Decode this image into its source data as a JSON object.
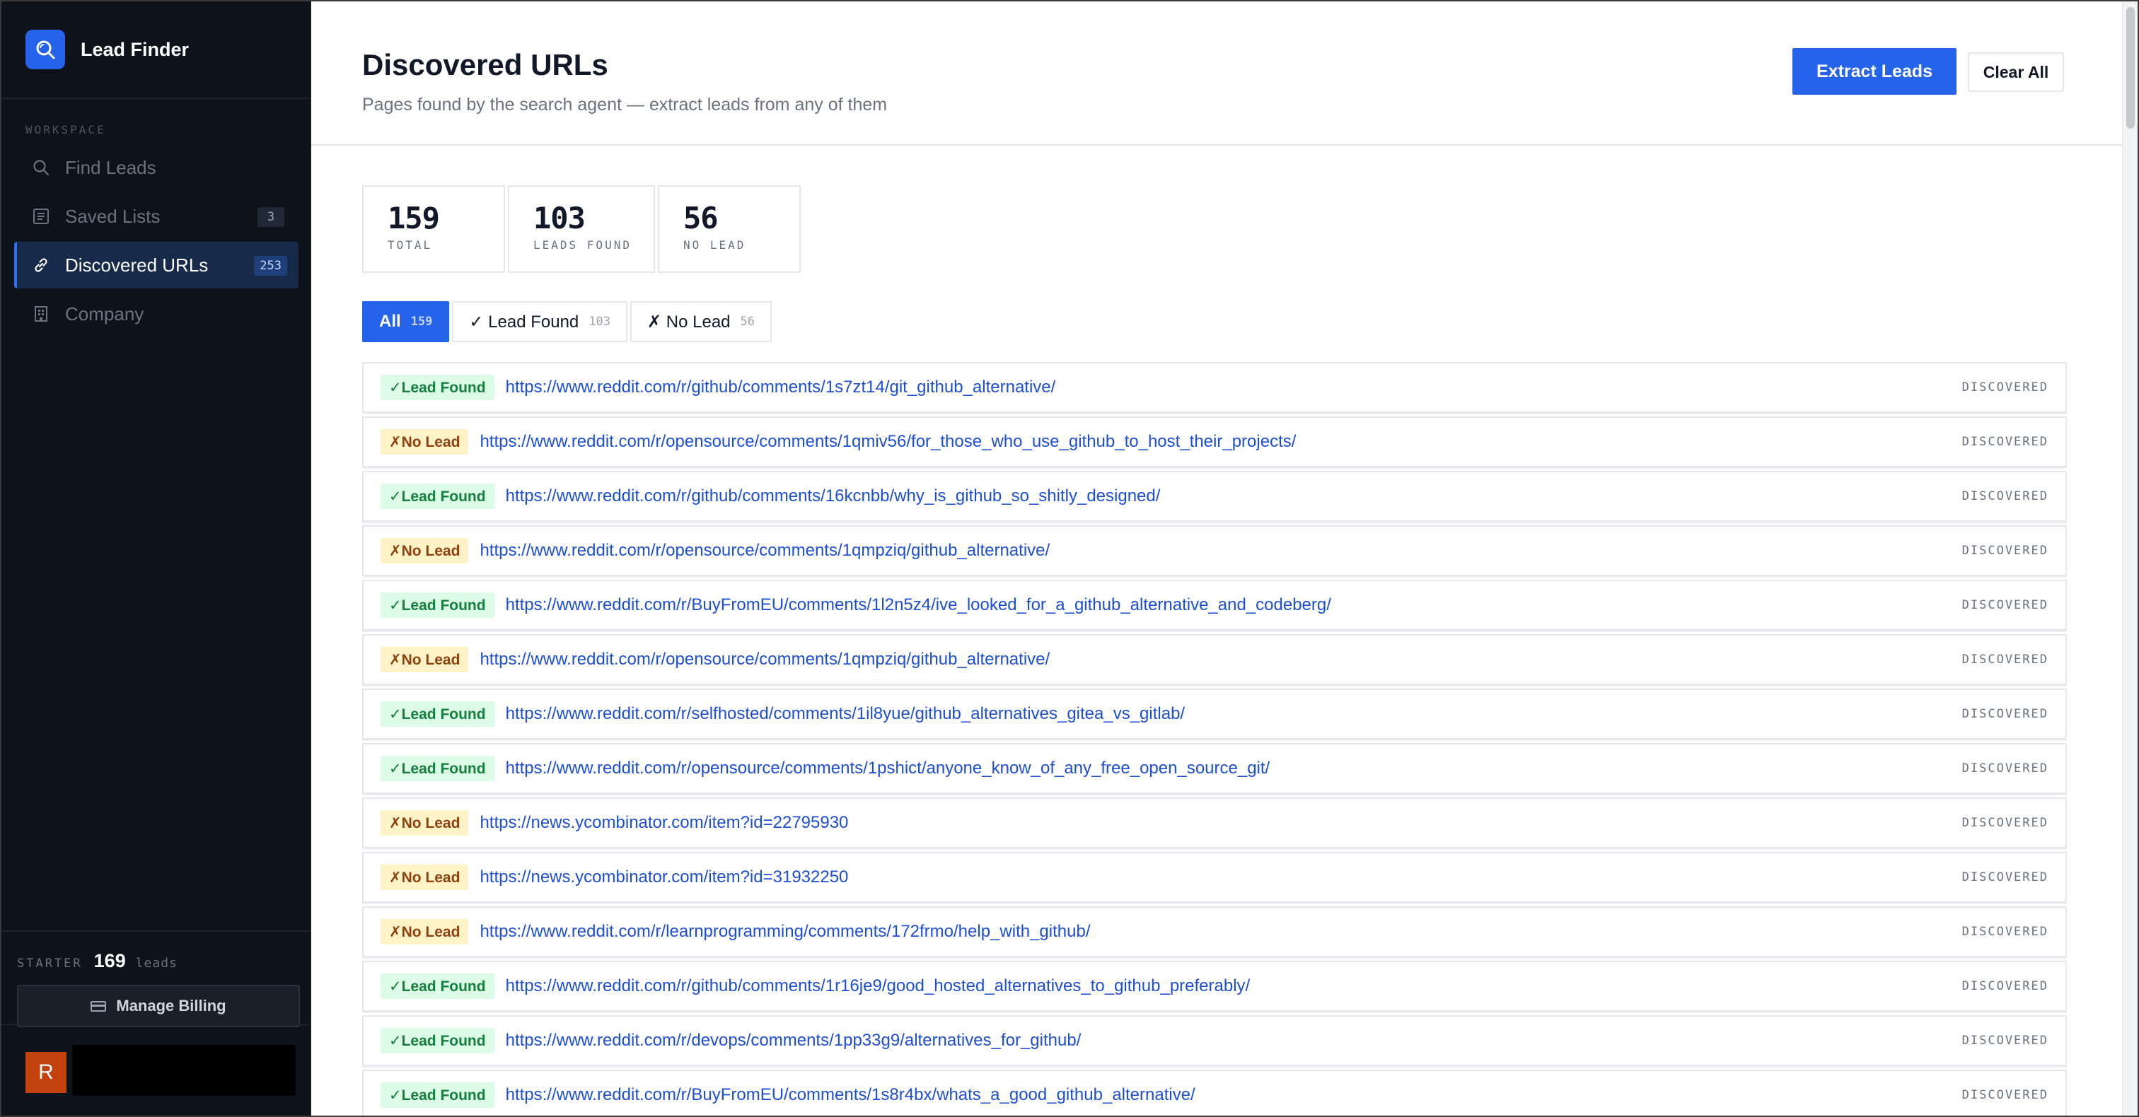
{
  "app": {
    "name": "Lead Finder"
  },
  "sidebar": {
    "section_label": "WORKSPACE",
    "items": [
      {
        "label": "Find Leads",
        "icon": "search-icon",
        "badge": ""
      },
      {
        "label": "Saved Lists",
        "icon": "list-icon",
        "badge": "3"
      },
      {
        "label": "Discovered URLs",
        "icon": "link-icon",
        "badge": "253",
        "active": true
      },
      {
        "label": "Company",
        "icon": "building-icon",
        "badge": ""
      }
    ],
    "plan": {
      "tier": "STARTER",
      "count": "169",
      "unit": "leads"
    },
    "billing_label": "Manage Billing",
    "user": {
      "avatar_initial": "R"
    }
  },
  "header": {
    "title": "Discovered URLs",
    "subtitle": "Pages found by the search agent — extract leads from any of them",
    "primary_action": "Extract Leads",
    "secondary_action": "Clear All"
  },
  "stats": [
    {
      "value": "159",
      "label": "TOTAL"
    },
    {
      "value": "103",
      "label": "LEADS FOUND"
    },
    {
      "value": "56",
      "label": "NO LEAD"
    }
  ],
  "tabs": [
    {
      "label": "All",
      "count": "159",
      "active": true
    },
    {
      "label": "✓ Lead Found",
      "count": "103"
    },
    {
      "label": "✗ No Lead",
      "count": "56"
    }
  ],
  "rows": [
    {
      "status": "lead",
      "pill": "✓Lead Found",
      "url": "https://www.reddit.com/r/github/comments/1s7zt14/git_github_alternative/",
      "state": "DISCOVERED"
    },
    {
      "status": "nolead",
      "pill": "✗No Lead",
      "url": "https://www.reddit.com/r/opensource/comments/1qmiv56/for_those_who_use_github_to_host_their_projects/",
      "state": "DISCOVERED"
    },
    {
      "status": "lead",
      "pill": "✓Lead Found",
      "url": "https://www.reddit.com/r/github/comments/16kcnbb/why_is_github_so_shitly_designed/",
      "state": "DISCOVERED"
    },
    {
      "status": "nolead",
      "pill": "✗No Lead",
      "url": "https://www.reddit.com/r/opensource/comments/1qmpziq/github_alternative/",
      "state": "DISCOVERED"
    },
    {
      "status": "lead",
      "pill": "✓Lead Found",
      "url": "https://www.reddit.com/r/BuyFromEU/comments/1l2n5z4/ive_looked_for_a_github_alternative_and_codeberg/",
      "state": "DISCOVERED"
    },
    {
      "status": "nolead",
      "pill": "✗No Lead",
      "url": "https://www.reddit.com/r/opensource/comments/1qmpziq/github_alternative/",
      "state": "DISCOVERED"
    },
    {
      "status": "lead",
      "pill": "✓Lead Found",
      "url": "https://www.reddit.com/r/selfhosted/comments/1il8yue/github_alternatives_gitea_vs_gitlab/",
      "state": "DISCOVERED"
    },
    {
      "status": "lead",
      "pill": "✓Lead Found",
      "url": "https://www.reddit.com/r/opensource/comments/1pshict/anyone_know_of_any_free_open_source_git/",
      "state": "DISCOVERED"
    },
    {
      "status": "nolead",
      "pill": "✗No Lead",
      "url": "https://news.ycombinator.com/item?id=22795930",
      "state": "DISCOVERED"
    },
    {
      "status": "nolead",
      "pill": "✗No Lead",
      "url": "https://news.ycombinator.com/item?id=31932250",
      "state": "DISCOVERED"
    },
    {
      "status": "nolead",
      "pill": "✗No Lead",
      "url": "https://www.reddit.com/r/learnprogramming/comments/172frmo/help_with_github/",
      "state": "DISCOVERED"
    },
    {
      "status": "lead",
      "pill": "✓Lead Found",
      "url": "https://www.reddit.com/r/github/comments/1r16je9/good_hosted_alternatives_to_github_preferably/",
      "state": "DISCOVERED"
    },
    {
      "status": "lead",
      "pill": "✓Lead Found",
      "url": "https://www.reddit.com/r/devops/comments/1pp33g9/alternatives_for_github/",
      "state": "DISCOVERED"
    },
    {
      "status": "lead",
      "pill": "✓Lead Found",
      "url": "https://www.reddit.com/r/BuyFromEU/comments/1s8r4bx/whats_a_good_github_alternative/",
      "state": "DISCOVERED"
    }
  ]
}
